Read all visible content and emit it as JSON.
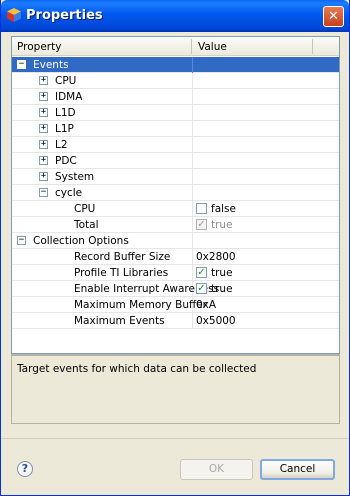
{
  "window": {
    "title": "Properties",
    "close_glyph": "✕"
  },
  "table": {
    "columns": [
      "Property",
      "Value"
    ],
    "rows": [
      {
        "label": "Events",
        "type": "group-expanded",
        "indent": 0,
        "selected": true,
        "expander": "−"
      },
      {
        "label": "CPU",
        "type": "group-collapsed",
        "indent": 1,
        "expander": "+"
      },
      {
        "label": "IDMA",
        "type": "group-collapsed",
        "indent": 1,
        "expander": "+"
      },
      {
        "label": "L1D",
        "type": "group-collapsed",
        "indent": 1,
        "expander": "+"
      },
      {
        "label": "L1P",
        "type": "group-collapsed",
        "indent": 1,
        "expander": "+"
      },
      {
        "label": "L2",
        "type": "group-collapsed",
        "indent": 1,
        "expander": "+"
      },
      {
        "label": "PDC",
        "type": "group-collapsed",
        "indent": 1,
        "expander": "+"
      },
      {
        "label": "System",
        "type": "group-collapsed",
        "indent": 1,
        "expander": "+"
      },
      {
        "label": "cycle",
        "type": "group-open",
        "indent": 1,
        "expander": "−"
      },
      {
        "label": "CPU",
        "type": "checkbox",
        "indent": 2,
        "checked": false,
        "disabled": false,
        "value": "false"
      },
      {
        "label": "Total",
        "type": "checkbox",
        "indent": 2,
        "checked": true,
        "disabled": true,
        "value": "true"
      },
      {
        "label": "Collection Options",
        "type": "group-expanded",
        "indent": 0,
        "expander": "−"
      },
      {
        "label": "Record Buffer Size",
        "type": "text",
        "indent": 2,
        "value": "0x2800"
      },
      {
        "label": "Profile TI Libraries",
        "type": "checkbox",
        "indent": 2,
        "checked": true,
        "disabled": false,
        "value": "true"
      },
      {
        "label": "Enable Interrupt Awareness",
        "type": "checkbox",
        "indent": 2,
        "checked": true,
        "disabled": false,
        "value": "true"
      },
      {
        "label": "Maximum Memory Buffer",
        "type": "text",
        "indent": 2,
        "value": "0xA"
      },
      {
        "label": "Maximum Events",
        "type": "text",
        "indent": 2,
        "value": "0x5000"
      }
    ]
  },
  "description": "Target events for which data can be collected",
  "buttons": {
    "help_glyph": "?",
    "ok": "OK",
    "cancel": "Cancel"
  },
  "colors": {
    "title_bar": "#0058ee",
    "selection": "#316ac5",
    "window_bg": "#ece9d8"
  }
}
